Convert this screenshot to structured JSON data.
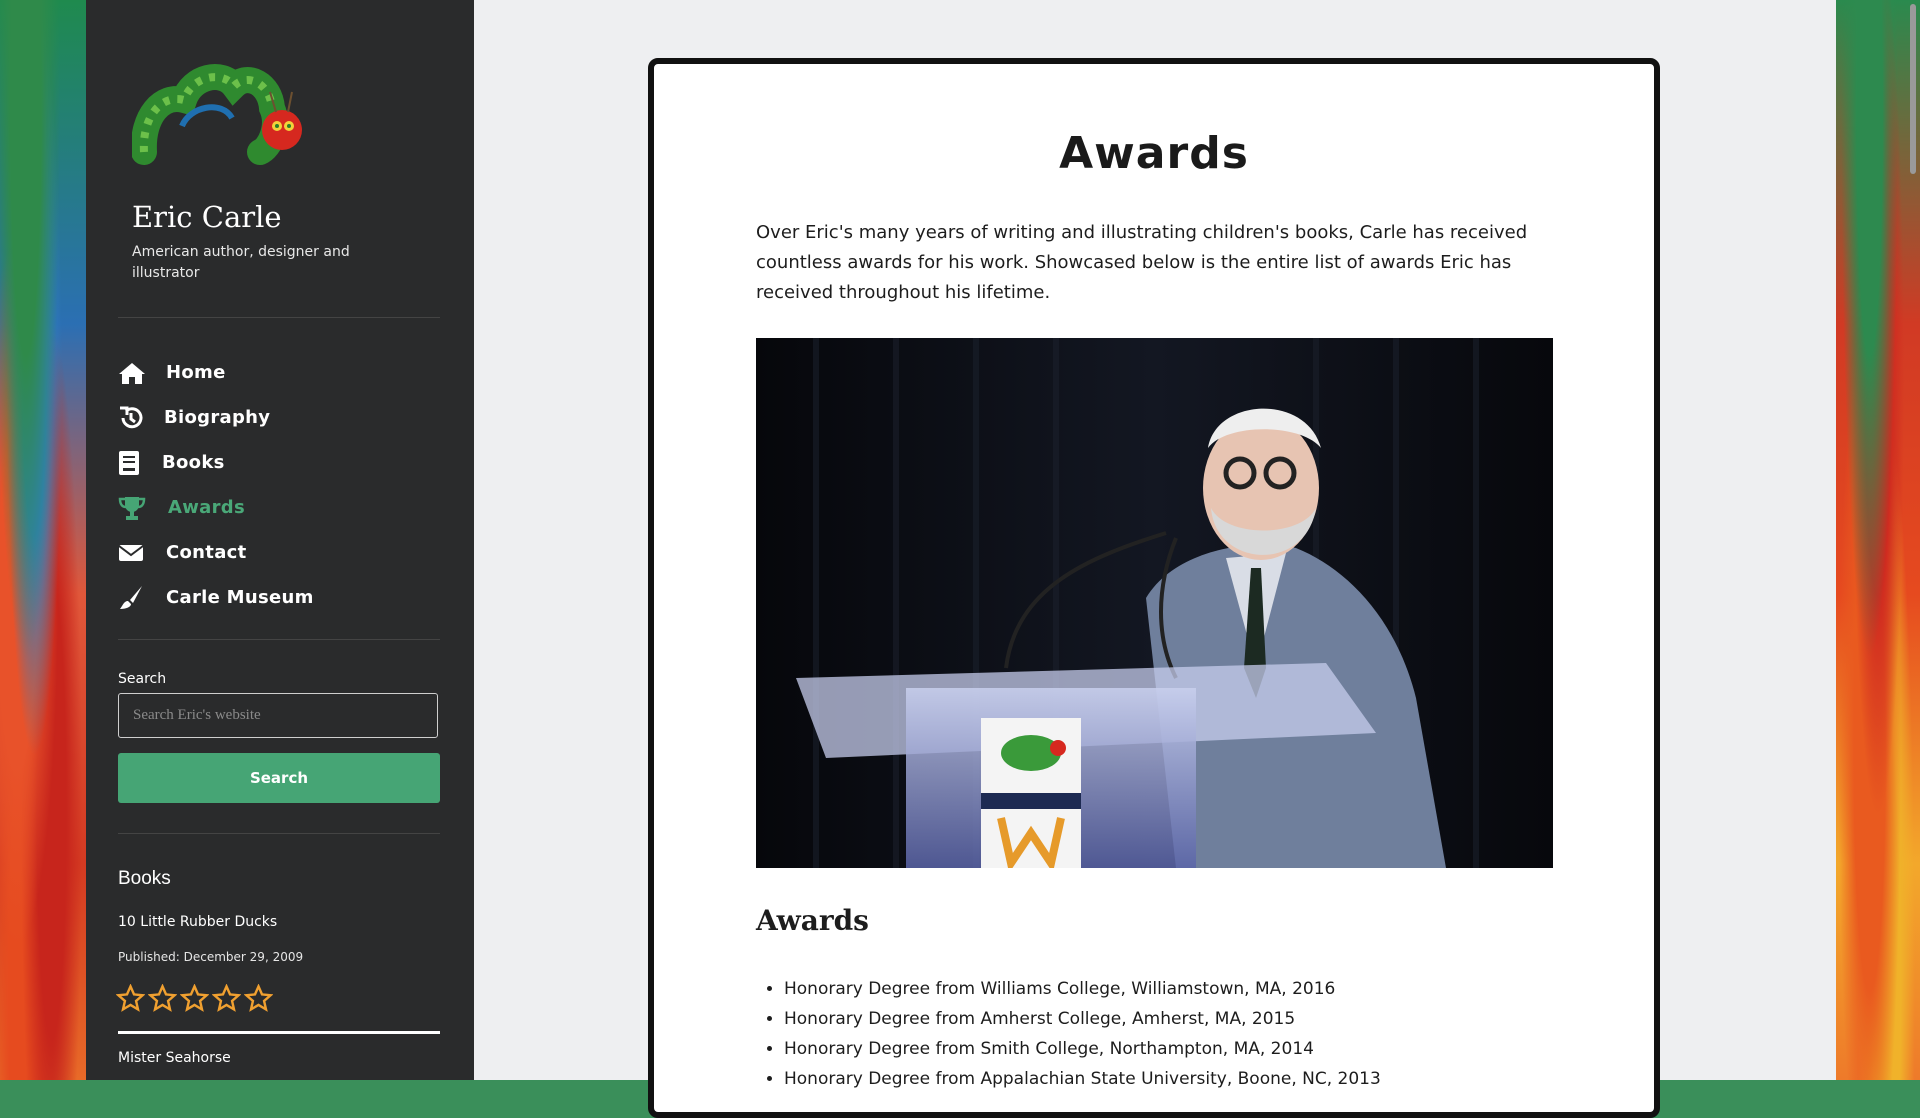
{
  "site": {
    "title": "Eric Carle",
    "tagline": "American author, designer and illustrator"
  },
  "nav": {
    "items": [
      {
        "label": "Home",
        "icon": "home-icon"
      },
      {
        "label": "Biography",
        "icon": "history-icon"
      },
      {
        "label": "Books",
        "icon": "book-icon"
      },
      {
        "label": "Awards",
        "icon": "trophy-icon",
        "active": true
      },
      {
        "label": "Contact",
        "icon": "envelope-icon"
      },
      {
        "label": "Carle Museum",
        "icon": "paintbrush-icon"
      }
    ]
  },
  "search": {
    "label": "Search",
    "placeholder": "Search Eric's website",
    "button": "Search"
  },
  "books_widget": {
    "title": "Books",
    "items": [
      {
        "title": "10 Little Rubber Ducks",
        "published": "Published: December 29, 2009",
        "rating": 0,
        "max_rating": 5
      },
      {
        "title": "Mister Seahorse"
      }
    ]
  },
  "page": {
    "title": "Awards",
    "intro": "Over Eric's many years of writing and illustrating children's books, Carle has received countless awards for his work. Showcased below is the entire list of awards Eric has received throughout his lifetime.",
    "section_title": "Awards",
    "awards": [
      "Honorary Degree from Williams College, Williamstown, MA, 2016",
      "Honorary Degree from Amherst College, Amherst, MA, 2015",
      "Honorary Degree from Smith College, Northampton, MA, 2014",
      "Honorary Degree from Appalachian State University, Boone, NC, 2013"
    ]
  },
  "colors": {
    "sidebar_bg": "#2a2b2c",
    "accent": "#46a575",
    "star": "#f0a030"
  }
}
